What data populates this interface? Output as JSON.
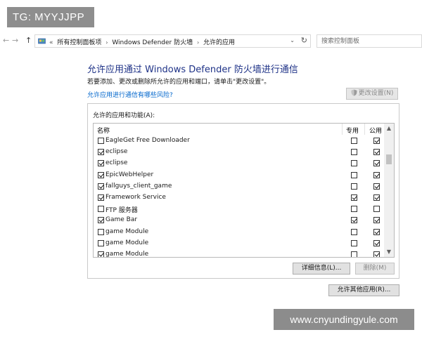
{
  "watermarks": {
    "top": "TG: MYYJJPP",
    "bottom": "www.cnyundingyule.com"
  },
  "nav": {
    "back_icon": "arrow-left-icon",
    "forward_icon": "arrow-right-icon",
    "up_icon": "arrow-up-icon",
    "breadcrumb_lead": "«",
    "breadcrumbs": [
      "所有控制面板项",
      "Windows Defender 防火墙",
      "允许的应用"
    ],
    "search_placeholder": "搜索控制面板"
  },
  "page": {
    "title": "允许应用通过 Windows Defender 防火墙进行通信",
    "subtitle": "若要添加、更改或删除所允许的应用和端口，请单击\"更改设置\"。",
    "risk_link": "允许应用进行通信有哪些风险?",
    "change_settings_label": "更改设置(N)"
  },
  "apps": {
    "group_label": "允许的应用和功能(A):",
    "columns": {
      "name": "名称",
      "private": "专用",
      "public": "公用"
    },
    "rows": [
      {
        "name": "EagleGet Free Downloader",
        "enabled": false,
        "private": false,
        "public": true
      },
      {
        "name": "eclipse",
        "enabled": true,
        "private": false,
        "public": true
      },
      {
        "name": "eclipse",
        "enabled": true,
        "private": false,
        "public": true
      },
      {
        "name": "EpicWebHelper",
        "enabled": true,
        "private": false,
        "public": true
      },
      {
        "name": "fallguys_client_game",
        "enabled": true,
        "private": false,
        "public": true
      },
      {
        "name": "Framework Service",
        "enabled": true,
        "private": true,
        "public": true
      },
      {
        "name": "FTP 服务器",
        "enabled": false,
        "private": false,
        "public": false
      },
      {
        "name": "Game Bar",
        "enabled": true,
        "private": true,
        "public": true
      },
      {
        "name": "game Module",
        "enabled": false,
        "private": false,
        "public": true
      },
      {
        "name": "game Module",
        "enabled": false,
        "private": false,
        "public": true
      },
      {
        "name": "game Module",
        "enabled": true,
        "private": false,
        "public": true
      }
    ],
    "details_label": "详细信息(L)...",
    "remove_label": "删除(M)",
    "allow_other_label": "允许其他应用(R)..."
  }
}
